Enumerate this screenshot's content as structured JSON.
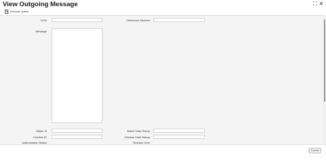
{
  "window": {
    "title": "View Outgoing Message",
    "maximize_icon": "⛶",
    "close_icon": "✕"
  },
  "toolbar": {
    "execute_query_label": "Execute Query"
  },
  "form": {
    "dcn_label": "DCN",
    "dcn_value": "",
    "reference_number_label": "Reference Number",
    "reference_number_value": "",
    "message_label": "Message",
    "message_value": "",
    "maker_id_label": "Maker Id",
    "maker_id_value": "",
    "maker_date_stamp_label": "Maker Date Stamp",
    "maker_date_stamp_value": "",
    "checker_id_label": "Checker ID",
    "checker_id_value": "",
    "checker_date_stamp_label": "Checker Date Stamp",
    "checker_date_stamp_value": "",
    "authorization_status_label": "Authorization Status",
    "release_time_label": "Release Time"
  },
  "footer": {
    "cancel_label": "Cancel"
  }
}
